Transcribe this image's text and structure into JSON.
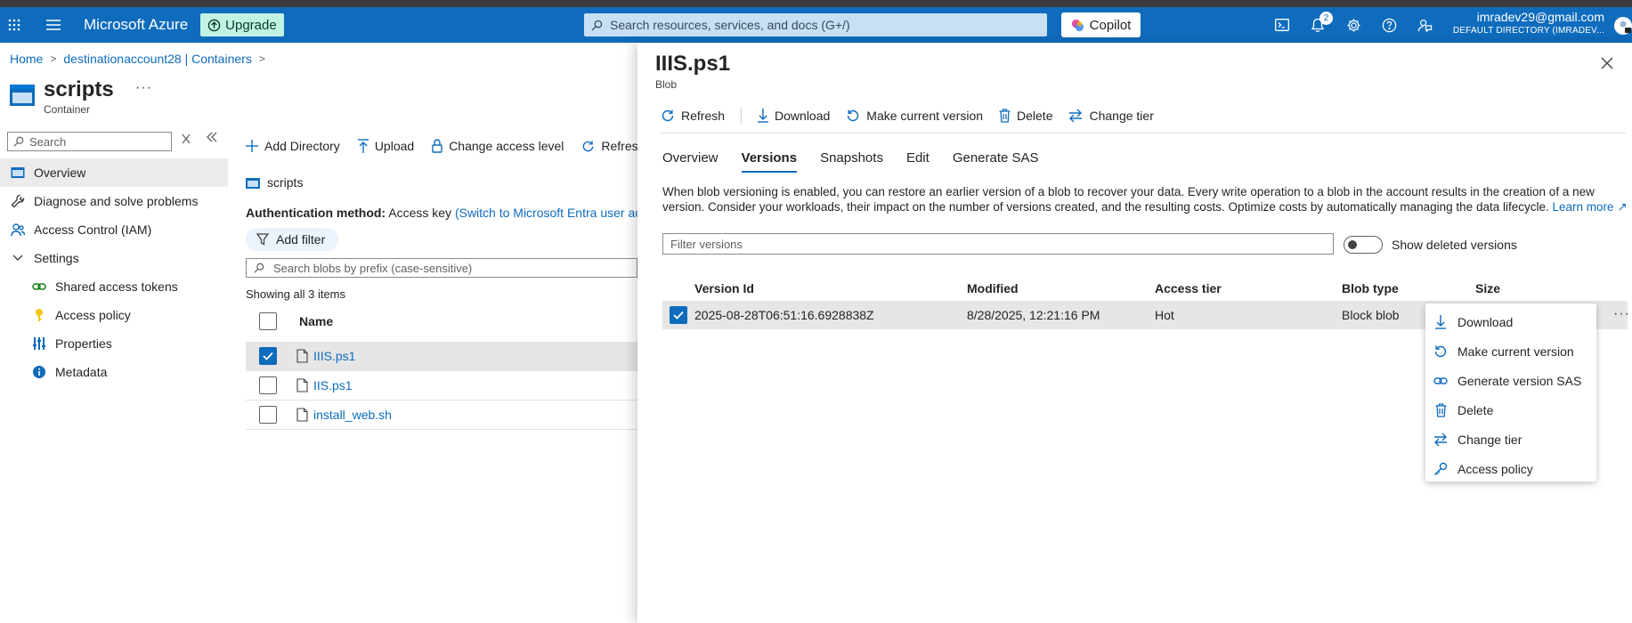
{
  "topbar": {
    "brand": "Microsoft Azure",
    "upgrade_label": "Upgrade",
    "search_placeholder": "Search resources, services, and docs (G+/)",
    "copilot_label": "Copilot",
    "notifications_count": "2",
    "account_email": "imradev29@gmail.com",
    "account_directory": "DEFAULT DIRECTORY (IMRADEV..."
  },
  "breadcrumb": {
    "home": "Home",
    "account": "destinationaccount28 | Containers"
  },
  "page": {
    "title": "scripts",
    "subtitle": "Container",
    "more": "···"
  },
  "nav": {
    "search_placeholder": "Search",
    "items": [
      {
        "label": "Overview"
      },
      {
        "label": "Diagnose and solve problems"
      },
      {
        "label": "Access Control (IAM)"
      },
      {
        "label": "Settings"
      },
      {
        "label": "Shared access tokens"
      },
      {
        "label": "Access policy"
      },
      {
        "label": "Properties"
      },
      {
        "label": "Metadata"
      }
    ]
  },
  "container": {
    "commands": {
      "add_directory": "Add Directory",
      "upload": "Upload",
      "change_access": "Change access level",
      "refresh": "Refresh"
    },
    "folder": "scripts",
    "auth_label": "Authentication method:",
    "auth_value": "Access key",
    "auth_link": "(Switch to Microsoft Entra user account)",
    "add_filter": "Add filter",
    "blob_search_placeholder": "Search blobs by prefix (case-sensitive)",
    "showing": "Showing all 3 items",
    "name_header": "Name",
    "blobs": [
      {
        "name": "IIIS.ps1",
        "selected": true
      },
      {
        "name": "IIS.ps1",
        "selected": false
      },
      {
        "name": "install_web.sh",
        "selected": false
      }
    ]
  },
  "panel": {
    "title": "IIIS.ps1",
    "subtitle": "Blob",
    "commands": {
      "refresh": "Refresh",
      "download": "Download",
      "make_current": "Make current version",
      "delete": "Delete",
      "change_tier": "Change tier"
    },
    "tabs": [
      {
        "label": "Overview",
        "active": false
      },
      {
        "label": "Versions",
        "active": true
      },
      {
        "label": "Snapshots",
        "active": false
      },
      {
        "label": "Edit",
        "active": false
      },
      {
        "label": "Generate SAS",
        "active": false
      }
    ],
    "info_text": "When blob versioning is enabled, you can restore an earlier version of a blob to recover your data. Every write operation to a blob in the account results in the creation of a new version. Consider your workloads, their impact on the number of versions created, and the resulting costs. Optimize costs by automatically managing the data lifecycle.",
    "learn_more": "Learn more",
    "filter_placeholder": "Filter versions",
    "show_deleted_label": "Show deleted versions",
    "table": {
      "headers": {
        "version_id": "Version Id",
        "modified": "Modified",
        "access_tier": "Access tier",
        "blob_type": "Blob type",
        "size": "Size"
      },
      "rows": [
        {
          "version_id": "2025-08-28T06:51:16.6928838Z",
          "modified": "8/28/2025, 12:21:16 PM",
          "access_tier": "Hot",
          "blob_type": "Block blob"
        }
      ]
    },
    "context_menu": [
      {
        "label": "Download",
        "icon": "download-icon"
      },
      {
        "label": "Make current version",
        "icon": "restore-icon"
      },
      {
        "label": "Generate version SAS",
        "icon": "link-icon"
      },
      {
        "label": "Delete",
        "icon": "trash-icon"
      },
      {
        "label": "Change tier",
        "icon": "swap-icon"
      },
      {
        "label": "Access policy",
        "icon": "key-icon"
      }
    ]
  },
  "colors": {
    "brand": "#0f6cbd",
    "upgrade_bg": "#c1f2e3"
  }
}
